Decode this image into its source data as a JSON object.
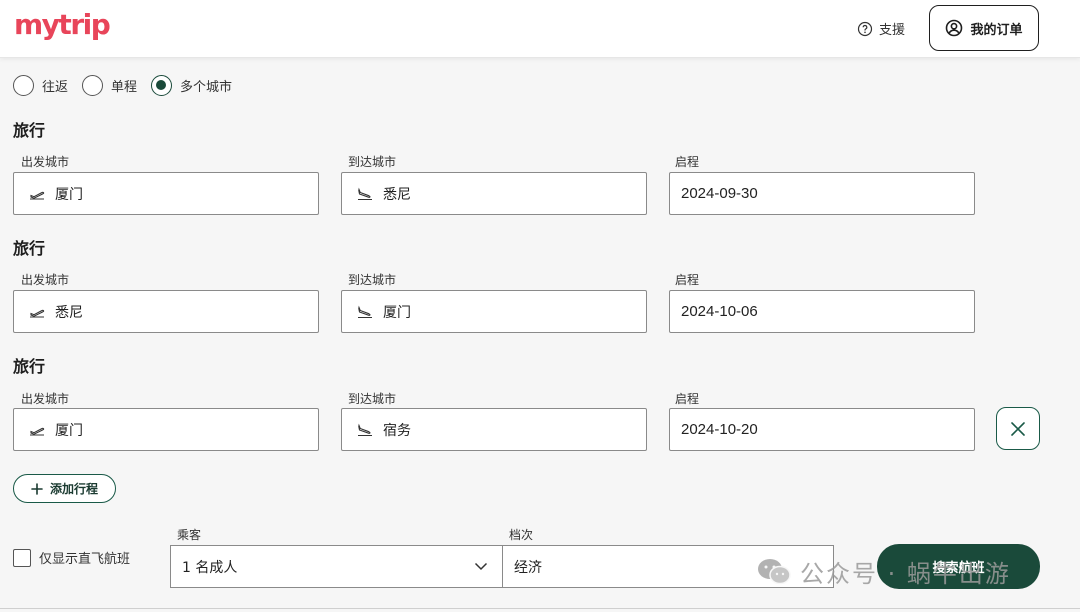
{
  "brand": {
    "logo": "mytrip",
    "color": "#e8455a"
  },
  "header": {
    "support_label": "支援",
    "orders_label": "我的订单"
  },
  "trip_types": [
    {
      "label": "往返",
      "checked": false
    },
    {
      "label": "单程",
      "checked": false
    },
    {
      "label": "多个城市",
      "checked": true
    }
  ],
  "legs": [
    {
      "title": "旅行",
      "from_label": "出发城市",
      "from": "厦门",
      "to_label": "到达城市",
      "to": "悉尼",
      "date_label": "启程",
      "date": "2024-09-30"
    },
    {
      "title": "旅行",
      "from_label": "出发城市",
      "from": "悉尼",
      "to_label": "到达城市",
      "to": "厦门",
      "date_label": "启程",
      "date": "2024-10-06"
    },
    {
      "title": "旅行",
      "from_label": "出发城市",
      "from": "厦门",
      "to_label": "到达城市",
      "to": "宿务",
      "date_label": "启程",
      "date": "2024-10-20"
    }
  ],
  "add_leg_label": "添加行程",
  "direct_only_label": "仅显示直飞航班",
  "passengers": {
    "label": "乘客",
    "value": "1 名成人"
  },
  "cabin": {
    "label": "档次",
    "value": "经济"
  },
  "search_label": "搜索航班",
  "watermark": "公众号 · 蜗牛出游",
  "colors": {
    "accent": "#1a4a3a",
    "brand": "#e8455a"
  }
}
